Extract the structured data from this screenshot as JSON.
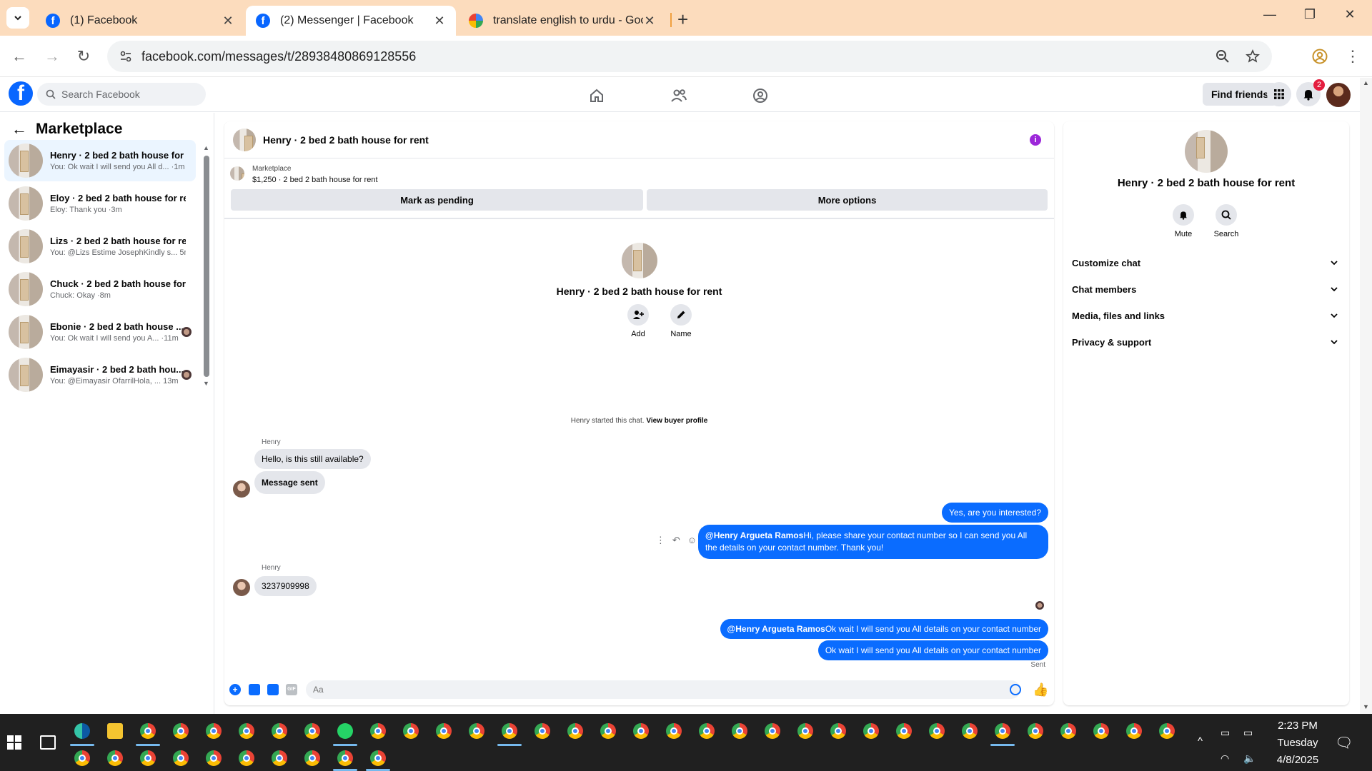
{
  "browser": {
    "tabs": [
      {
        "title": "(1) Facebook",
        "active": false
      },
      {
        "title": "(2) Messenger | Facebook",
        "active": true
      },
      {
        "title": "translate english to urdu - Goog",
        "active": false
      }
    ],
    "url": "facebook.com/messages/t/28938480869128556"
  },
  "fb": {
    "search_placeholder": "Search Facebook",
    "find_friends": "Find friends",
    "notification_count": "2",
    "brand_color": "#0866ff"
  },
  "sidebar": {
    "title": "Marketplace",
    "conversations": [
      {
        "name": "Henry · 2 bed 2 bath house for ...",
        "snippet": "You: Ok wait I will send you All d... ·1m",
        "active": true,
        "seen": false
      },
      {
        "name": "Eloy · 2 bed 2 bath house for re...",
        "snippet": "Eloy: Thank you ·3m",
        "active": false,
        "seen": false
      },
      {
        "name": "Lizs · 2 bed 2 bath house for rent",
        "snippet": "You: @Lizs Estime JosephKindly s...  5m",
        "active": false,
        "seen": false
      },
      {
        "name": "Chuck · 2 bed 2 bath house for ...",
        "snippet": "Chuck: Okay ·8m",
        "active": false,
        "seen": false
      },
      {
        "name": "Ebonie · 2 bed 2 bath house ...",
        "snippet": "You: Ok wait I will send you A... ·11m",
        "active": false,
        "seen": true
      },
      {
        "name": "Eimayasir · 2 bed 2 bath hou...",
        "snippet": "You: @Eimayasir OfarrilHola, ... 13m",
        "active": false,
        "seen": true
      }
    ]
  },
  "chat": {
    "title": "Henry · 2 bed 2 bath house for rent",
    "listing_label": "Marketplace",
    "listing_price": "$1,250 · 2 bed 2 bath house for rent",
    "mark_pending": "Mark as pending",
    "more_options": "More options",
    "intro_name": "Henry · 2 bed 2 bath house for rent",
    "add_label": "Add",
    "name_label": "Name",
    "started_text": "Henry started this chat. ",
    "view_buyer": "View buyer profile",
    "sender_name": "Henry",
    "msg1": "Hello, is this still available?",
    "msg2": "Message sent",
    "msg3": "Yes, are you interested?",
    "msg4_mention": "@Henry Argueta Ramos",
    "msg4_text": "Hi, please share your contact number so I can send you All the details on your contact number. Thank you!",
    "msg5": "3237909998",
    "msg6_mention": "@Henry Argueta Ramos",
    "msg6_text": "Ok wait I will send you All details on your contact number",
    "msg7": "Ok wait I will send you All details on your contact number",
    "sent_status": "Sent",
    "composer_placeholder": "Aa",
    "accent_color": "#0a6cff"
  },
  "details": {
    "name": "Henry · 2 bed 2 bath house for rent",
    "mute": "Mute",
    "search": "Search",
    "sections": [
      "Customize chat",
      "Chat members",
      "Media, files and links",
      "Privacy & support"
    ]
  },
  "taskbar": {
    "time": "2:23 PM",
    "day": "Tuesday",
    "date": "4/8/2025"
  }
}
